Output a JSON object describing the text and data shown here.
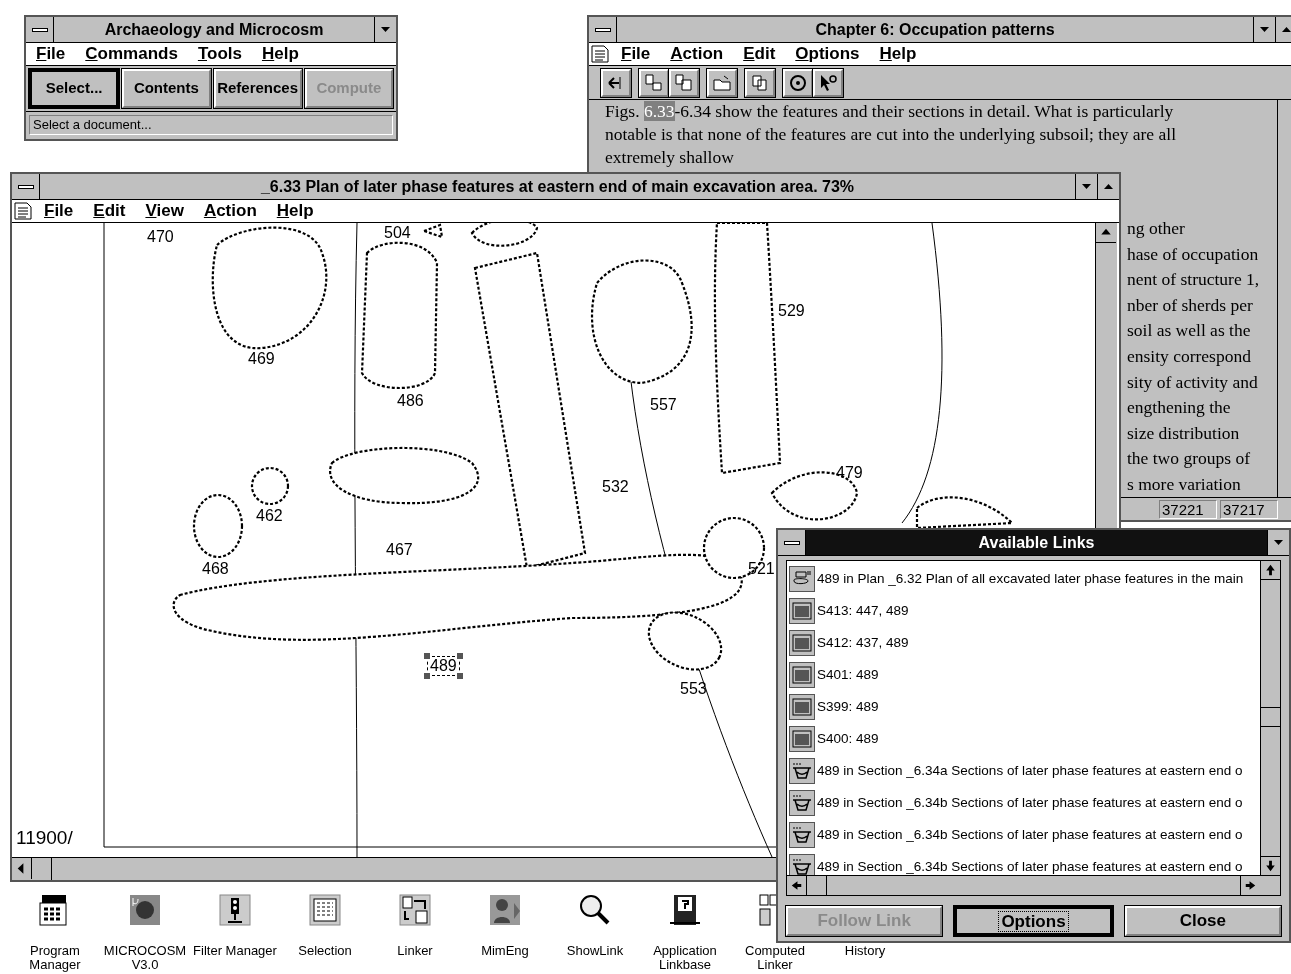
{
  "launcher": {
    "title": "Archaeology and Microcosm",
    "menu": [
      "File",
      "Commands",
      "Tools",
      "Help"
    ],
    "buttons": [
      {
        "label": "Select...",
        "disabled": false,
        "focused": true
      },
      {
        "label": "Contents",
        "disabled": false,
        "focused": false
      },
      {
        "label": "References",
        "disabled": false,
        "focused": false
      },
      {
        "label": "Compute",
        "disabled": true,
        "focused": false
      }
    ],
    "status": "Select a document..."
  },
  "chapter": {
    "title": "Chapter  6: Occupation patterns",
    "menu": [
      "File",
      "Action",
      "Edit",
      "Options",
      "Help"
    ],
    "first_line": {
      "before": "Figs. ",
      "highlight": "6.33",
      "after": "-6.34 show the features and their sections in detail.  What is particularly"
    },
    "lines": [
      "notable is that none of the features are cut into the underlying subsoil;  they are all",
      "extremely shallow"
    ],
    "fragments": [
      "ng other",
      "hase of occupation",
      "nent of structure 1,",
      "nber of sherds per",
      "soil as well as the",
      "ensity correspond",
      "sity of activity and",
      "engthening the",
      "size distribution",
      "the two groups of",
      "s more variation"
    ],
    "status_cells": [
      "37221",
      "37217"
    ]
  },
  "plan": {
    "title": "_6.33 Plan of later phase features at eastern end of main excavation area. 73%",
    "menu": [
      "File",
      "Edit",
      "View",
      "Action",
      "Help"
    ],
    "labels": [
      {
        "text": "470",
        "selected": false
      },
      {
        "text": "504",
        "selected": false
      },
      {
        "text": "469",
        "selected": false
      },
      {
        "text": "486",
        "selected": false
      },
      {
        "text": "557",
        "selected": false
      },
      {
        "text": "529",
        "selected": false
      },
      {
        "text": "532",
        "selected": false
      },
      {
        "text": "479",
        "selected": false
      },
      {
        "text": "462",
        "selected": false
      },
      {
        "text": "467",
        "selected": false
      },
      {
        "text": "468",
        "selected": false
      },
      {
        "text": "521",
        "selected": false
      },
      {
        "text": "489",
        "selected": true
      },
      {
        "text": "553",
        "selected": false
      },
      {
        "text": "11900/",
        "selected": false
      }
    ]
  },
  "links": {
    "title": "Available Links",
    "items": [
      {
        "kind": "plan",
        "text": "489 in Plan _6.32 Plan of all excavated later phase features in the main"
      },
      {
        "kind": "slide",
        "text": "S413: 447, 489"
      },
      {
        "kind": "slide",
        "text": "S412: 437, 489"
      },
      {
        "kind": "slide",
        "text": "S401: 489"
      },
      {
        "kind": "slide",
        "text": "S399: 489"
      },
      {
        "kind": "slide",
        "text": "S400: 489"
      },
      {
        "kind": "section",
        "text": "489 in Section _6.34a Sections of later phase features at eastern end o"
      },
      {
        "kind": "section",
        "text": "489 in Section _6.34b Sections of later phase features at eastern end o"
      },
      {
        "kind": "section",
        "text": "489 in Section _6.34b Sections of later phase features at eastern end o"
      },
      {
        "kind": "section",
        "text": "489 in Section _6.34b Sections of later phase features at eastern end o"
      }
    ],
    "buttons": [
      {
        "label": "Follow Link",
        "disabled": true,
        "focused": false
      },
      {
        "label": "Options",
        "disabled": false,
        "focused": true
      },
      {
        "label": "Close",
        "disabled": false,
        "focused": false
      }
    ]
  },
  "desktop_icons": [
    {
      "kind": "program-manager",
      "label": "Program Manager"
    },
    {
      "kind": "microcosm",
      "label": "MICROCOSM V3.0"
    },
    {
      "kind": "traffic-light",
      "label": "Filter Manager"
    },
    {
      "kind": "list",
      "label": "Selection"
    },
    {
      "kind": "linker",
      "label": "Linker"
    },
    {
      "kind": "mimeng",
      "label": "MimEng"
    },
    {
      "kind": "magnifier",
      "label": "ShowLink"
    },
    {
      "kind": "linkbase",
      "label": "Application Linkbase"
    },
    {
      "kind": "computed",
      "label": "Computed Linker"
    },
    {
      "kind": "none",
      "label": "History"
    }
  ]
}
